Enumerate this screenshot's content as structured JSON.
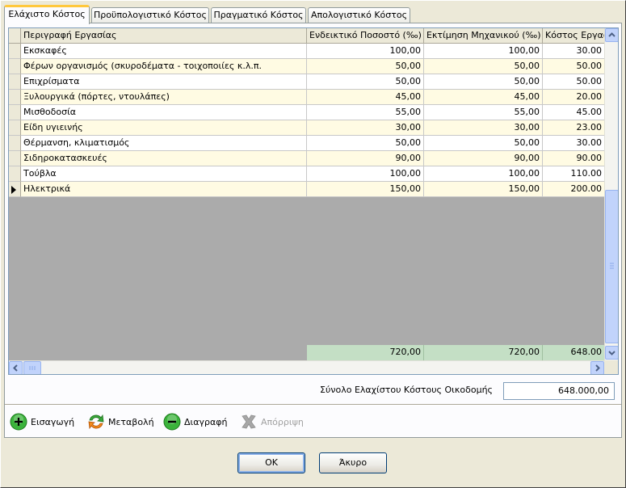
{
  "tabs": [
    {
      "label": "Ελάχιστο Κόστος",
      "active": true
    },
    {
      "label": "Προϋπολογιστικό Κόστος",
      "active": false
    },
    {
      "label": "Πραγματικό Κόστος",
      "active": false
    },
    {
      "label": "Απολογιστικό Κόστος",
      "active": false
    }
  ],
  "grid": {
    "columns": [
      "Περιγραφή Εργασίας",
      "Ενδεικτικό Ποσοστό (‰)",
      "Εκτίμηση Μηχανικού (‰)",
      "Κόστος Εργασ"
    ],
    "rows": [
      [
        "Εκσκαφές",
        "100,00",
        "100,00",
        "30.00"
      ],
      [
        "Φέρων οργανισμός (σκυροδέματα - τοιχοποιίες κ.λ.π.",
        "50,00",
        "50,00",
        "50.00"
      ],
      [
        "Επιχρίσματα",
        "50,00",
        "50,00",
        "50.00"
      ],
      [
        "Ξυλουργικά (πόρτες, ντουλάπες)",
        "45,00",
        "45,00",
        "20.00"
      ],
      [
        "Μισθοδοσία",
        "55,00",
        "55,00",
        "45.00"
      ],
      [
        "Είδη υγιεινής",
        "30,00",
        "30,00",
        "23.00"
      ],
      [
        "Θέρμανση, κλιματισμός",
        "50,00",
        "50,00",
        "30.00"
      ],
      [
        "Σιδηροκατασκευές",
        "90,00",
        "90,00",
        "90.00"
      ],
      [
        "Τούβλα",
        "100,00",
        "100,00",
        "110.00"
      ],
      [
        "Ηλεκτρικά",
        "150,00",
        "150,00",
        "200.00"
      ]
    ],
    "current_row_index": 9,
    "totals": [
      "720,00",
      "720,00",
      "648.00"
    ]
  },
  "summary": {
    "label": "Σύνολο Ελαχίστου Κόστους Οικοδομής",
    "value": "648.000,00"
  },
  "actions": {
    "insert": "Εισαγωγή",
    "edit": "Μεταβολή",
    "delete": "Διαγραφή",
    "reject": "Απόρριψη"
  },
  "dialog": {
    "ok": "OK",
    "cancel": "Άκυρο"
  },
  "colors": {
    "alt_row": "#fffbe3",
    "total_row": "#c4dfc5",
    "active_tab_accent": "#ffc83c"
  }
}
